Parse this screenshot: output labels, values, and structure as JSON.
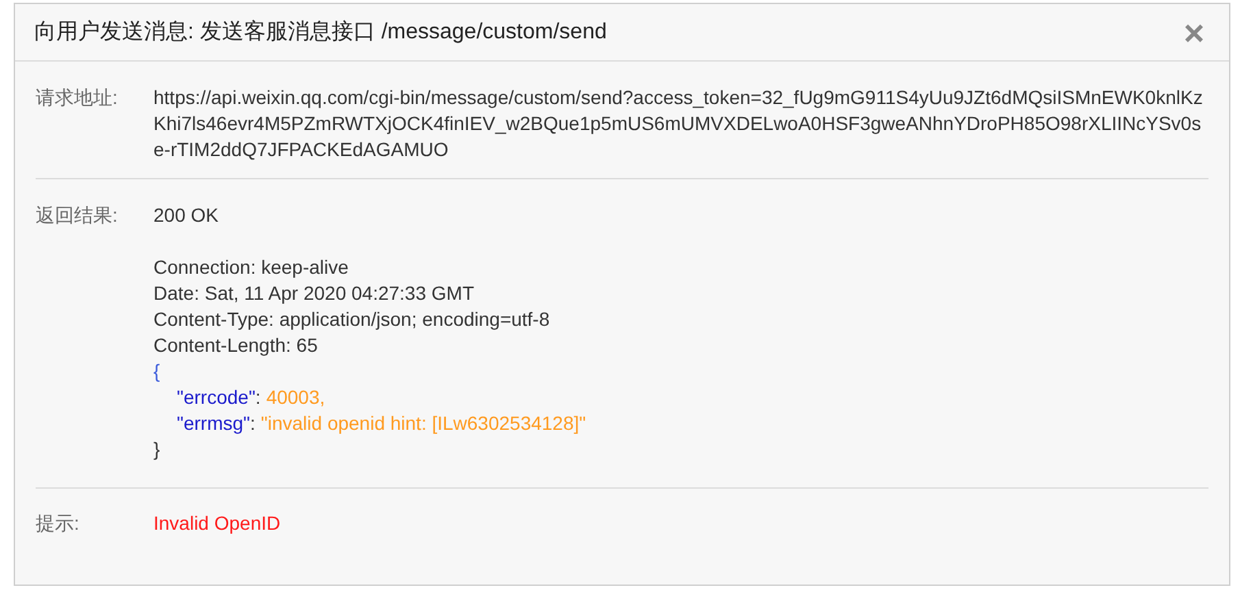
{
  "dialog": {
    "title": "向用户发送消息: 发送客服消息接口 /message/custom/send",
    "close": "×"
  },
  "request": {
    "label": "请求地址:",
    "url": "https://api.weixin.qq.com/cgi-bin/message/custom/send?access_token=32_fUg9mG911S4yUu9JZt6dMQsiISMnEWK0knlKzKhi7ls46evr4M5PZmRWTXjOCK4finIEV_w2BQue1p5mUS6mUMVXDELwoA0HSF3gweANhnYDroPH85O98rXLIINcYSv0se-rTIM2ddQ7JFPACKEdAGAMUO"
  },
  "response": {
    "label": "返回结果:",
    "status": "200 OK",
    "headers": [
      "Connection: keep-alive",
      "Date: Sat, 11 Apr 2020 04:27:33 GMT",
      "Content-Type: application/json; encoding=utf-8",
      "Content-Length: 65"
    ],
    "body": {
      "open": "{",
      "close": "}",
      "entries": [
        {
          "key": "\"errcode\"",
          "separator": ":",
          "value": "40003,"
        },
        {
          "key": "\"errmsg\"",
          "separator": ":",
          "value": "\"invalid openid hint: [ILw6302534128]\""
        }
      ]
    }
  },
  "hint": {
    "label": "提示:",
    "message": "Invalid OpenID"
  }
}
